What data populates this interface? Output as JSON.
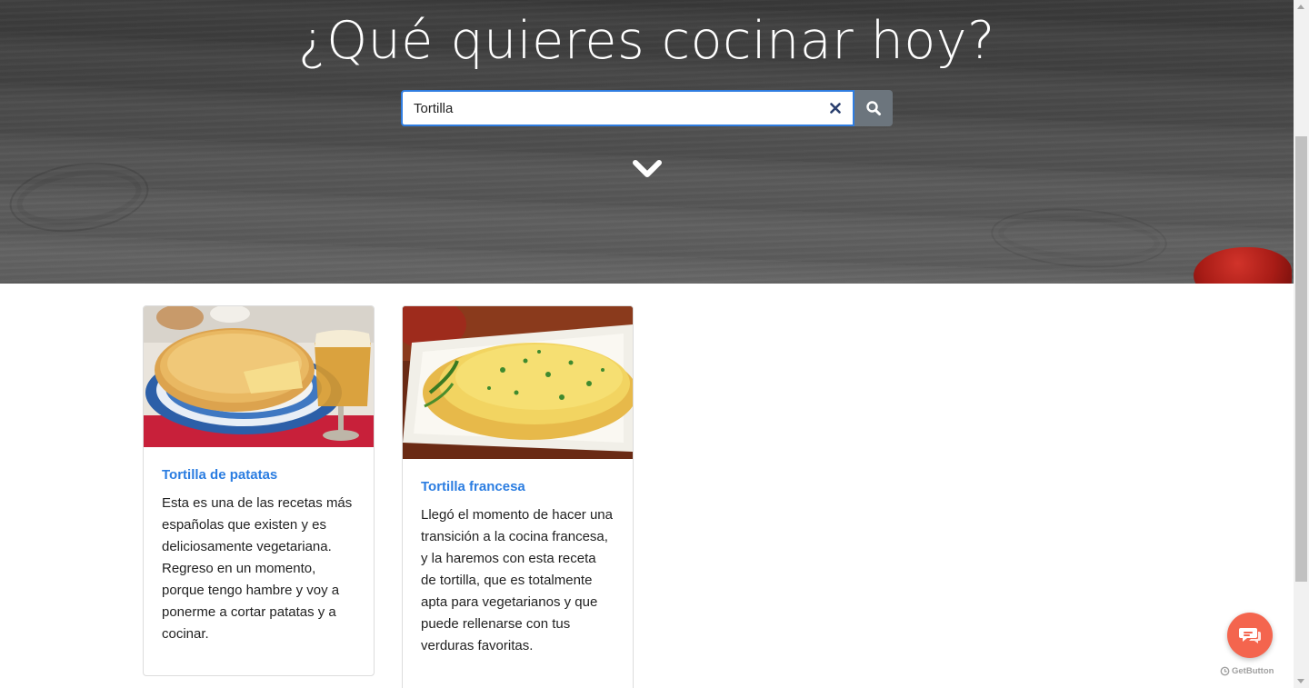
{
  "hero": {
    "title": "¿Qué quieres cocinar hoy?",
    "search": {
      "value": "Tortilla",
      "clear_icon": "close-icon",
      "button_icon": "search-icon"
    },
    "scroll_down_icon": "chevron-down-icon"
  },
  "recipes": [
    {
      "title": "Tortilla de patatas",
      "description": "Esta es una de las recetas más españolas que existen y es deliciosamente vegetariana. Regreso en un momento, porque tengo hambre y voy a ponerme a cortar patatas y a cocinar."
    },
    {
      "title": "Tortilla francesa",
      "description": "Llegó el momento de hacer una transición a la cocina francesa, y la haremos con esta receta de tortilla, que es totalmente apta para vegetarianos y que puede rellenarse con tus verduras favoritas."
    }
  ],
  "widget": {
    "chat_icon": "chat-bubbles-icon",
    "brand": "GetButton"
  },
  "colors": {
    "accent": "#2b7de1",
    "search_button": "#6c757d",
    "chat_button": "#f4654e"
  }
}
